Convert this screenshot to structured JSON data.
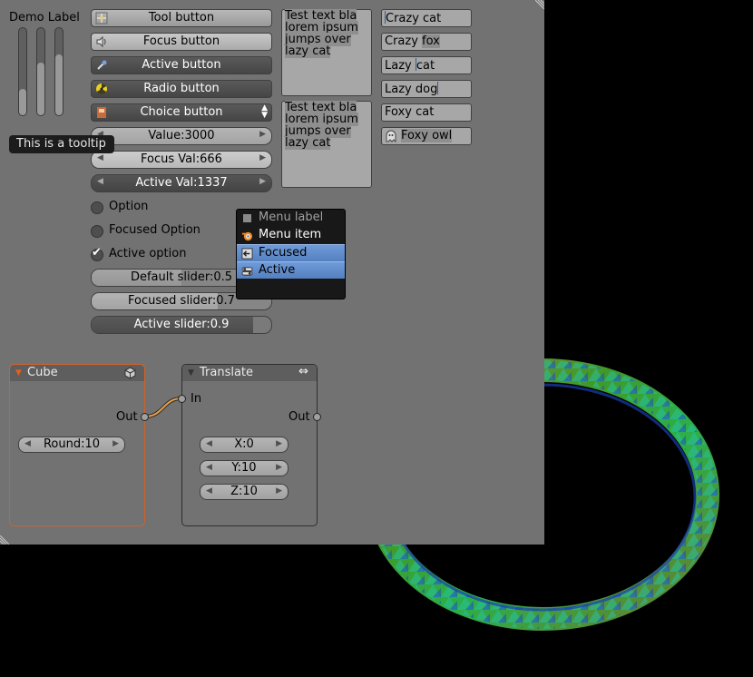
{
  "demo_label": "Demo Label",
  "vsliders": [
    0.3,
    0.6,
    0.7
  ],
  "buttons": {
    "tool": "Tool button",
    "focus": "Focus button",
    "active": "Active button",
    "radio": "Radio button",
    "choice": "Choice button"
  },
  "numbers": {
    "value": "Value:3000",
    "focus": "Focus Val:666",
    "active": "Active Val:1337"
  },
  "tooltip": "This is a tooltip",
  "textboxes": [
    [
      "Test text bla",
      "lorem ipsum",
      "jumps over",
      "lazy cat"
    ],
    [
      "Test text bla",
      "lorem ipsum",
      "jumps over",
      "lazy cat"
    ]
  ],
  "edits": {
    "e1": "Crazy cat",
    "e2a": "Crazy ",
    "e2b": "fox",
    "e3a": "Lazy ",
    "e3b": "cat",
    "e4": "Lazy dog",
    "e5": "Foxy cat",
    "e6": "Foxy owl"
  },
  "options": {
    "option": "Option",
    "focused": "Focused Option",
    "active": "Active option"
  },
  "sliders": {
    "default": {
      "label": "Default slider:0.5",
      "value": 0.5
    },
    "focused": {
      "label": "Focused slider:0.7",
      "value": 0.7
    },
    "active": {
      "label": "Active slider:0.9",
      "value": 0.9
    }
  },
  "menu": {
    "label": "Menu label",
    "item": "Menu item",
    "focused": "Focused",
    "active": "Active"
  },
  "node_cube": {
    "title": "Cube",
    "out": "Out",
    "round": "Round:10"
  },
  "node_translate": {
    "title": "Translate",
    "in": "In",
    "out": "Out",
    "x": "X:0",
    "y": "Y:10",
    "z": "Z:10"
  },
  "colors": {
    "panel": "#727272",
    "selection": "#5a86c6",
    "cube_border": "#d0622a",
    "link": "#e8a04a"
  }
}
